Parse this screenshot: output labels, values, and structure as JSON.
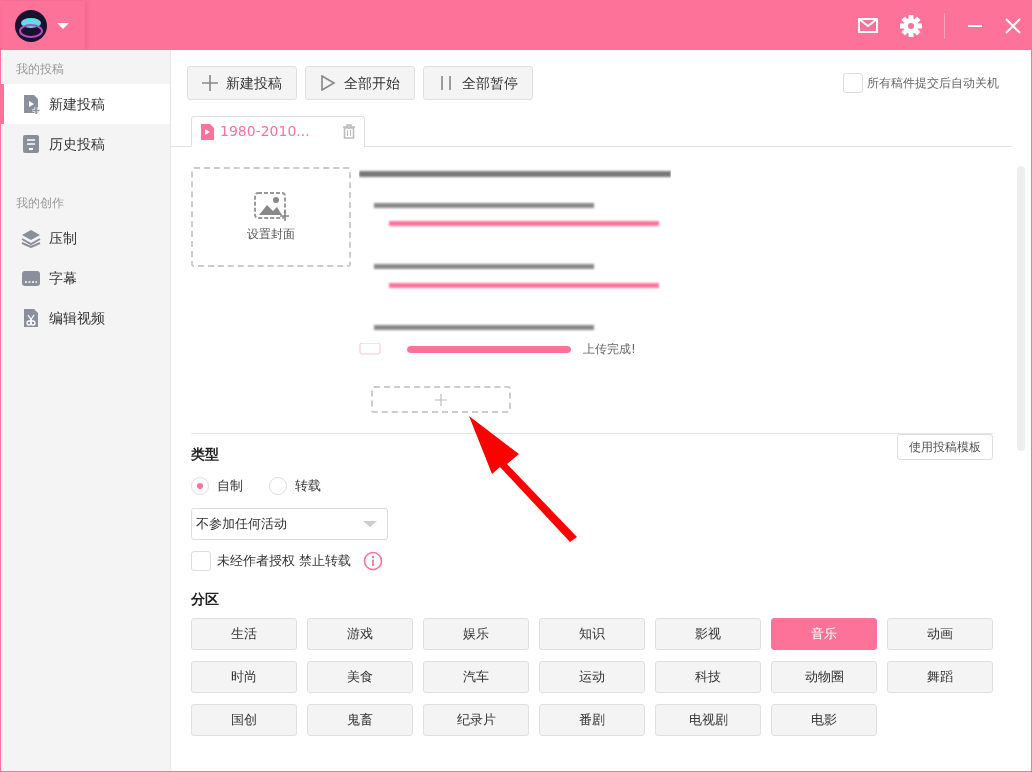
{
  "sidebar": {
    "groups": [
      {
        "label": "我的投稿",
        "items": [
          {
            "label": "新建投稿",
            "selected": true
          },
          {
            "label": "历史投稿",
            "selected": false
          }
        ]
      },
      {
        "label": "我的创作",
        "items": [
          {
            "label": "压制",
            "selected": false
          },
          {
            "label": "字幕",
            "selected": false
          },
          {
            "label": "编辑视频",
            "selected": false
          }
        ]
      }
    ]
  },
  "toolbar": {
    "buttons": [
      {
        "label": "新建投稿"
      },
      {
        "label": "全部开始"
      },
      {
        "label": "全部暂停"
      }
    ],
    "auto_shutdown": {
      "label": "所有稿件提交后自动关机",
      "checked": false
    }
  },
  "file_tabs": [
    {
      "label": "1980-2010...",
      "selected": true
    }
  ],
  "cover": {
    "label": "设置封面"
  },
  "upload": {
    "level": 1,
    "status": "上传完成!"
  },
  "template_button": "使用投稿模板",
  "type_section": {
    "title": "类型",
    "options": [
      {
        "label": "自制",
        "selected": true
      },
      {
        "label": "转载",
        "selected": false
      }
    ],
    "activity": {
      "value": "不参加任何活动"
    },
    "no_repost": {
      "label": "未经作者授权 禁止转载",
      "checked": false
    }
  },
  "zone_section": {
    "title": "分区",
    "zones": [
      {
        "label": "生活",
        "selected": false
      },
      {
        "label": "游戏",
        "selected": false
      },
      {
        "label": "娱乐",
        "selected": false
      },
      {
        "label": "知识",
        "selected": false
      },
      {
        "label": "影视",
        "selected": false
      },
      {
        "label": "音乐",
        "selected": true
      },
      {
        "label": "动画",
        "selected": false
      },
      {
        "label": "时尚",
        "selected": false
      },
      {
        "label": "美食",
        "selected": false
      },
      {
        "label": "汽车",
        "selected": false
      },
      {
        "label": "运动",
        "selected": false
      },
      {
        "label": "科技",
        "selected": false
      },
      {
        "label": "动物圈",
        "selected": false
      },
      {
        "label": "舞蹈",
        "selected": false
      },
      {
        "label": "国创",
        "selected": false
      },
      {
        "label": "鬼畜",
        "selected": false
      },
      {
        "label": "纪录片",
        "selected": false
      },
      {
        "label": "番剧",
        "selected": false
      },
      {
        "label": "电视剧",
        "selected": false
      },
      {
        "label": "电影",
        "selected": false
      }
    ]
  }
}
